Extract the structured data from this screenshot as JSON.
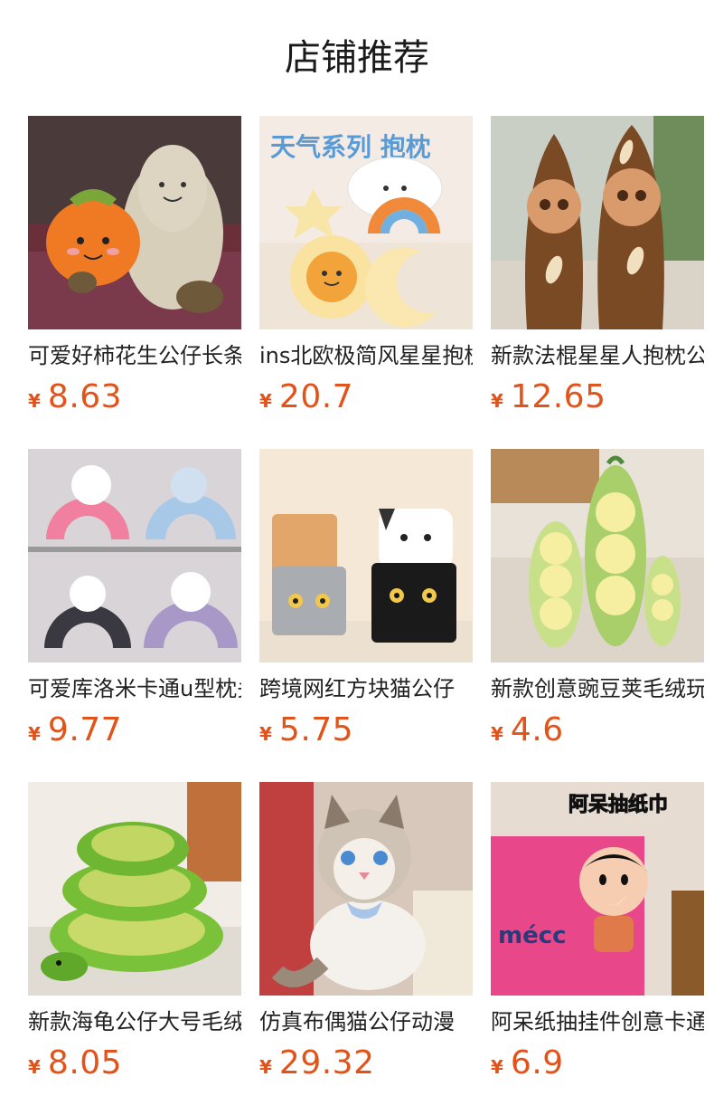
{
  "header": {
    "title": "店铺推荐"
  },
  "currency": "¥",
  "products": [
    {
      "name": "可爱好柿花生公仔长条抱枕",
      "price": "8.63",
      "image": "persimmon-peanut-plush",
      "thumb_text": ""
    },
    {
      "name": "ins北欧极简风星星抱枕",
      "price": "20.7",
      "image": "weather-series-pillow",
      "thumb_text": "天气系列 抱枕"
    },
    {
      "name": "新款法棍星星人抱枕公仔",
      "price": "12.65",
      "image": "baguette-doll-plush",
      "thumb_text": ""
    },
    {
      "name": "可爱库洛米卡通u型枕头",
      "price": "9.77",
      "image": "kuromi-u-pillow",
      "thumb_text": ""
    },
    {
      "name": "跨境网红方块猫公仔",
      "price": "5.75",
      "image": "cube-cat-plush",
      "thumb_text": ""
    },
    {
      "name": "新款创意豌豆荚毛绒玩具",
      "price": "4.6",
      "image": "pea-pod-plush",
      "thumb_text": ""
    },
    {
      "name": "新款海龟公仔大号毛绒",
      "price": "8.05",
      "image": "sea-turtle-plush",
      "thumb_text": ""
    },
    {
      "name": "仿真布偶猫公仔动漫",
      "price": "29.32",
      "image": "ragdoll-cat-plush",
      "thumb_text": ""
    },
    {
      "name": "阿呆纸抽挂件创意卡通",
      "price": "6.9",
      "image": "tissue-holder-doll",
      "thumb_text": "阿呆抽纸巾"
    }
  ]
}
